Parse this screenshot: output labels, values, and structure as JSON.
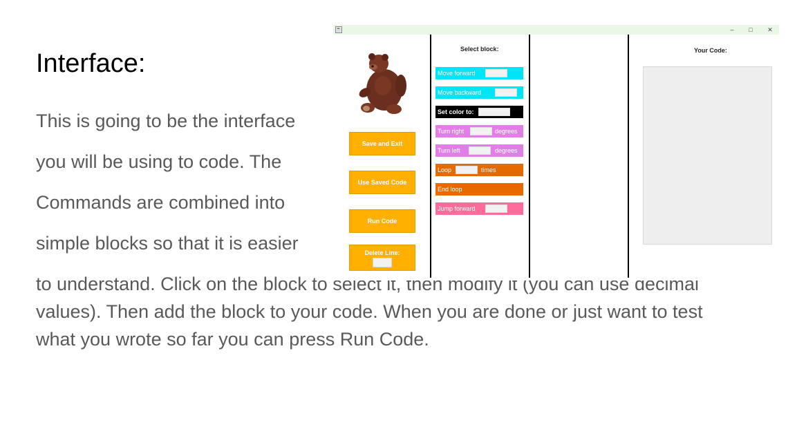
{
  "slide": {
    "title": "Interface:",
    "paragraph_lines": [
      "This is going to be the interface",
      "you will be using to code. The",
      "Commands are combined into",
      "simple blocks so that it is easier",
      "to understand. Click on the block to select it, then modify it (you can use decimal",
      "values). Then add the block to your code. When you are done or just want to test",
      "what you wrote so far you can press Run Code."
    ]
  },
  "app": {
    "window_controls": {
      "minimize": "–",
      "maximize": "□",
      "close": "✕"
    },
    "buttons": {
      "save_exit": "Save and Exit",
      "use_saved": "Use Saved Code",
      "run": "Run Code",
      "delete_line": "Delete Line:"
    },
    "select_heading": "Select block:",
    "code_heading": "Your Code:",
    "blocks": {
      "move_forward": {
        "label": "Move forward",
        "color": "#00e5f5"
      },
      "move_backward": {
        "label": "Move backward",
        "color": "#00e5f5"
      },
      "set_color": {
        "label": "Set color to:",
        "color": "#000000"
      },
      "turn_right": {
        "label": "Turn right",
        "suffix": "degrees",
        "color": "#e27fe6"
      },
      "turn_left": {
        "label": "Turn left",
        "suffix": "degrees",
        "color": "#e27fe6"
      },
      "loop": {
        "label": "Loop",
        "suffix": "times",
        "color": "#e76a00"
      },
      "end_loop": {
        "label": "End loop",
        "color": "#e76a00"
      },
      "jump_forward": {
        "label": "Jump forward",
        "color": "#ff6c9c"
      }
    },
    "icons": {
      "app": "java-app-icon",
      "bear": "teddy-bear-image"
    }
  }
}
